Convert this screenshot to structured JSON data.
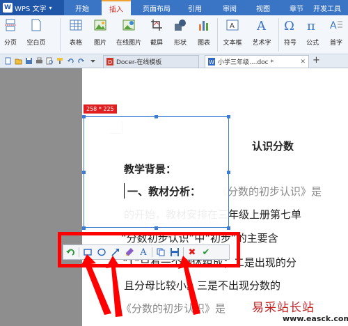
{
  "menubar": {
    "app_name": "WPS 文字",
    "tabs": [
      {
        "label": "开始"
      },
      {
        "label": "插入"
      },
      {
        "label": "页面布局"
      },
      {
        "label": "引用"
      },
      {
        "label": "审阅"
      },
      {
        "label": "视图"
      },
      {
        "label": "章节"
      },
      {
        "label": "开发工具"
      }
    ],
    "active_tab": "插入"
  },
  "ribbon": {
    "buttons": [
      {
        "label": "分页",
        "icon": "page-break-icon"
      },
      {
        "label": "空白页",
        "icon": "blank-page-icon"
      },
      {
        "label": "表格",
        "icon": "table-icon"
      },
      {
        "label": "图片",
        "icon": "picture-icon"
      },
      {
        "label": "在线图片",
        "icon": "online-picture-icon"
      },
      {
        "label": "截屏",
        "icon": "screenshot-icon"
      },
      {
        "label": "形状",
        "icon": "shapes-icon"
      },
      {
        "label": "图表",
        "icon": "chart-icon"
      },
      {
        "label": "文本框",
        "icon": "textbox-icon"
      },
      {
        "label": "艺术字",
        "icon": "wordart-icon"
      },
      {
        "label": "符号",
        "icon": "symbol-icon"
      },
      {
        "label": "公式",
        "icon": "formula-icon"
      },
      {
        "label": "首字",
        "icon": "dropcap-icon"
      }
    ]
  },
  "tabbar": {
    "tabs": [
      {
        "label": "Docer-在线模板"
      },
      {
        "label": "小学三年级....doc *"
      }
    ],
    "add_label": "+"
  },
  "document": {
    "title": "认识分数",
    "heading": "教学背景：",
    "subheading": "一、教材分析：",
    "lines": [
      "《分数的初步认识》是",
      "的开始，教材安排在三年级上册第七单",
      "“分数初步认识”中“初步”的主要含",
      "“1”只有一个物体组成；二是出现的分",
      "且分母比较小。三是不出现分数的",
      "《分数的初步认识》是"
    ]
  },
  "screenshot": {
    "size_label": "258 * 225"
  },
  "toolbar_tools": [
    {
      "name": "undo-icon"
    },
    {
      "name": "rectangle-icon"
    },
    {
      "name": "ellipse-icon"
    },
    {
      "name": "arrow-icon"
    },
    {
      "name": "brush-icon"
    },
    {
      "name": "text-icon",
      "label": "A"
    },
    {
      "name": "copy-icon"
    },
    {
      "name": "save-icon"
    },
    {
      "name": "cancel-icon",
      "label": "✖"
    },
    {
      "name": "confirm-icon",
      "label": "✔"
    }
  ],
  "watermark": {
    "title": "易采站长站",
    "url": "www.easck.com"
  },
  "colors": {
    "menubar": "#3a74c4",
    "highlight": "#ff0000",
    "selection": "#3d7bd9"
  }
}
